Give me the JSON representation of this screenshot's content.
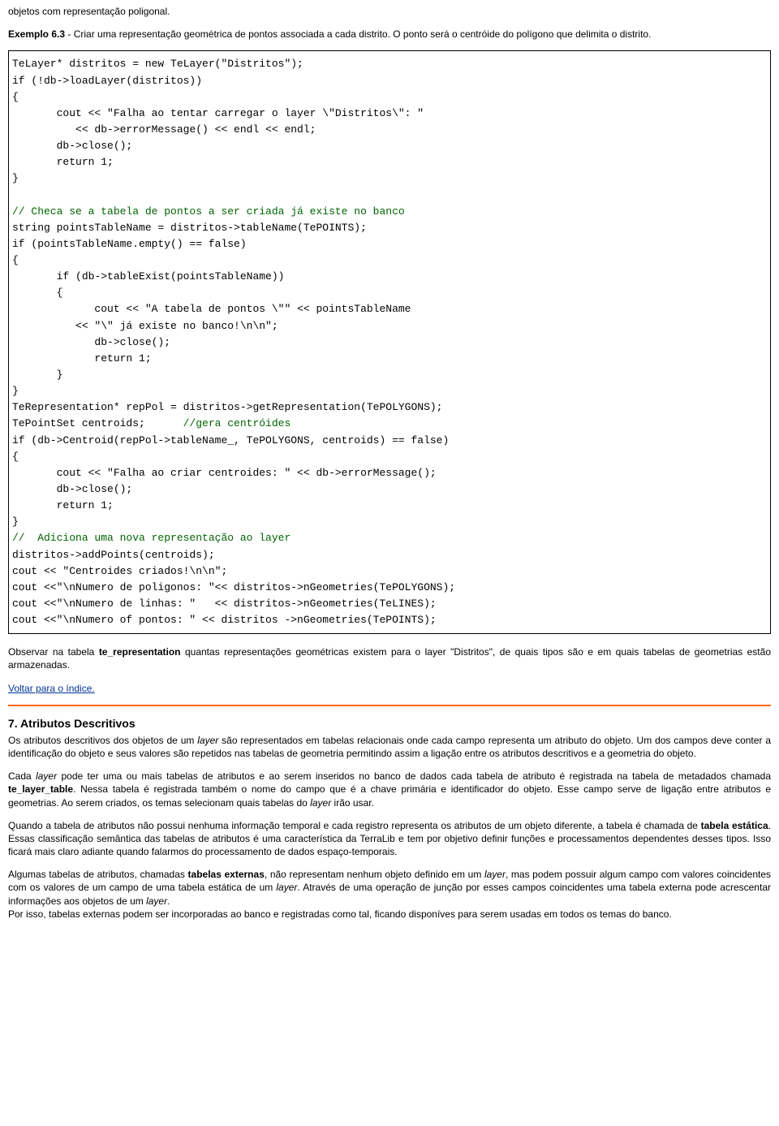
{
  "intro": {
    "p1": "objetos com representação poligonal.",
    "p2_bold": "Exemplo 6.3",
    "p2_rest": " - Criar uma representação geométrica de pontos associada a cada distrito. O ponto será o centróide do polígono que delimita o distrito."
  },
  "code": {
    "l1": "TeLayer* distritos = new TeLayer(\"Distritos\");",
    "l2": "if (!db->loadLayer(distritos))",
    "l3": "{",
    "l4": "       cout << \"Falha ao tentar carregar o layer \\\"Distritos\\\": \"",
    "l5": "          << db->errorMessage() << endl << endl;",
    "l6": "       db->close();",
    "l7": "       return 1;",
    "l8": "}",
    "l9": "",
    "l10": "// Checa se a tabela de pontos a ser criada já existe no banco",
    "l11": "string pointsTableName = distritos->tableName(TePOINTS);",
    "l12": "if (pointsTableName.empty() == false)",
    "l13": "{",
    "l14": "       if (db->tableExist(pointsTableName))",
    "l15": "       {",
    "l16": "             cout << \"A tabela de pontos \\\"\" << pointsTableName",
    "l17": "          << \"\\\" já existe no banco!\\n\\n\";",
    "l18": "             db->close();",
    "l19": "             return 1;",
    "l20": "       }",
    "l21": "}",
    "l22": "TeRepresentation* repPol = distritos->getRepresentation(TePOLYGONS);",
    "l23a": "TePointSet centroids;      ",
    "l23b": "//gera centróides",
    "l24": "if (db->Centroid(repPol->tableName_, TePOLYGONS, centroids) == false)",
    "l25": "{",
    "l26": "       cout << \"Falha ao criar centroides: \" << db->errorMessage();",
    "l27": "       db->close();",
    "l28": "       return 1;",
    "l29": "}",
    "l30": "//  Adiciona uma nova representação ao layer",
    "l31": "distritos->addPoints(centroids);",
    "l32": "cout << \"Centroides criados!\\n\\n\";",
    "l33": "cout <<\"\\nNumero de poligonos: \"<< distritos->nGeometries(TePOLYGONS);",
    "l34": "cout <<\"\\nNumero de linhas: \"   << distritos->nGeometries(TeLINES);",
    "l35": "cout <<\"\\nNumero of pontos: \" << distritos ->nGeometries(TePOINTS);"
  },
  "obs": {
    "pre": "Observar na tabela ",
    "bold": "te_representation",
    "post": " quantas representações geométricas existem para o layer \"Distritos\", de quais tipos são e em quais tabelas de geometrias estão armazenadas."
  },
  "link": "Voltar para o índice.",
  "section_title": "7. Atributos Descritivos",
  "para1": {
    "a": "Os atributos descritivos dos objetos de um ",
    "b": "layer",
    "c": " são representados em tabelas relacionais onde cada campo representa um atributo do objeto. Um dos campos deve conter a identificação do objeto e seus valores são repetidos nas tabelas de geometria permitindo assim a ligação entre os atributos descritivos e a geometria do objeto."
  },
  "para2": {
    "a": "Cada ",
    "b": "layer",
    "c": " pode ter uma ou mais tabelas de atributos e ao serem inseridos no banco de dados cada tabela de atributo é registrada na tabela de metadados chamada ",
    "d": "te_layer_table",
    "e": ". Nessa tabela é registrada também o nome do campo que é a chave primária e identificador do objeto. Esse campo serve de ligação entre atributos e geometrias. Ao serem criados, os temas selecionam quais tabelas do ",
    "f": "layer",
    "g": " irão usar."
  },
  "para3": {
    "a": "Quando a tabela de atributos não possui nenhuma informação temporal e cada registro representa os atributos de um objeto diferente, a tabela é chamada de ",
    "b": "tabela estática",
    "c": ". Essas classificação semântica das tabelas de atributos é uma característica da TerraLib e tem por objetivo definir funções e processamentos dependentes desses tipos. Isso ficará mais claro adiante quando falarmos do processamento de dados espaço-temporais."
  },
  "para4": {
    "a": "Algumas tabelas de atributos, chamadas ",
    "b": "tabelas externas",
    "c": ", não representam nenhum objeto definido em um ",
    "d": "layer",
    "e": ", mas podem possuir algum campo com valores coincidentes com os valores de um campo de uma tabela estática de um ",
    "f": "layer",
    "g": ". Através de uma operação de junção por esses campos coincidentes uma tabela externa pode acrescentar informações aos objetos de um ",
    "h": "layer",
    "i": ".",
    "j": "Por isso, tabelas externas podem ser incorporadas ao banco e registradas como tal, ficando disponíves para serem usadas em todos os temas do banco."
  }
}
